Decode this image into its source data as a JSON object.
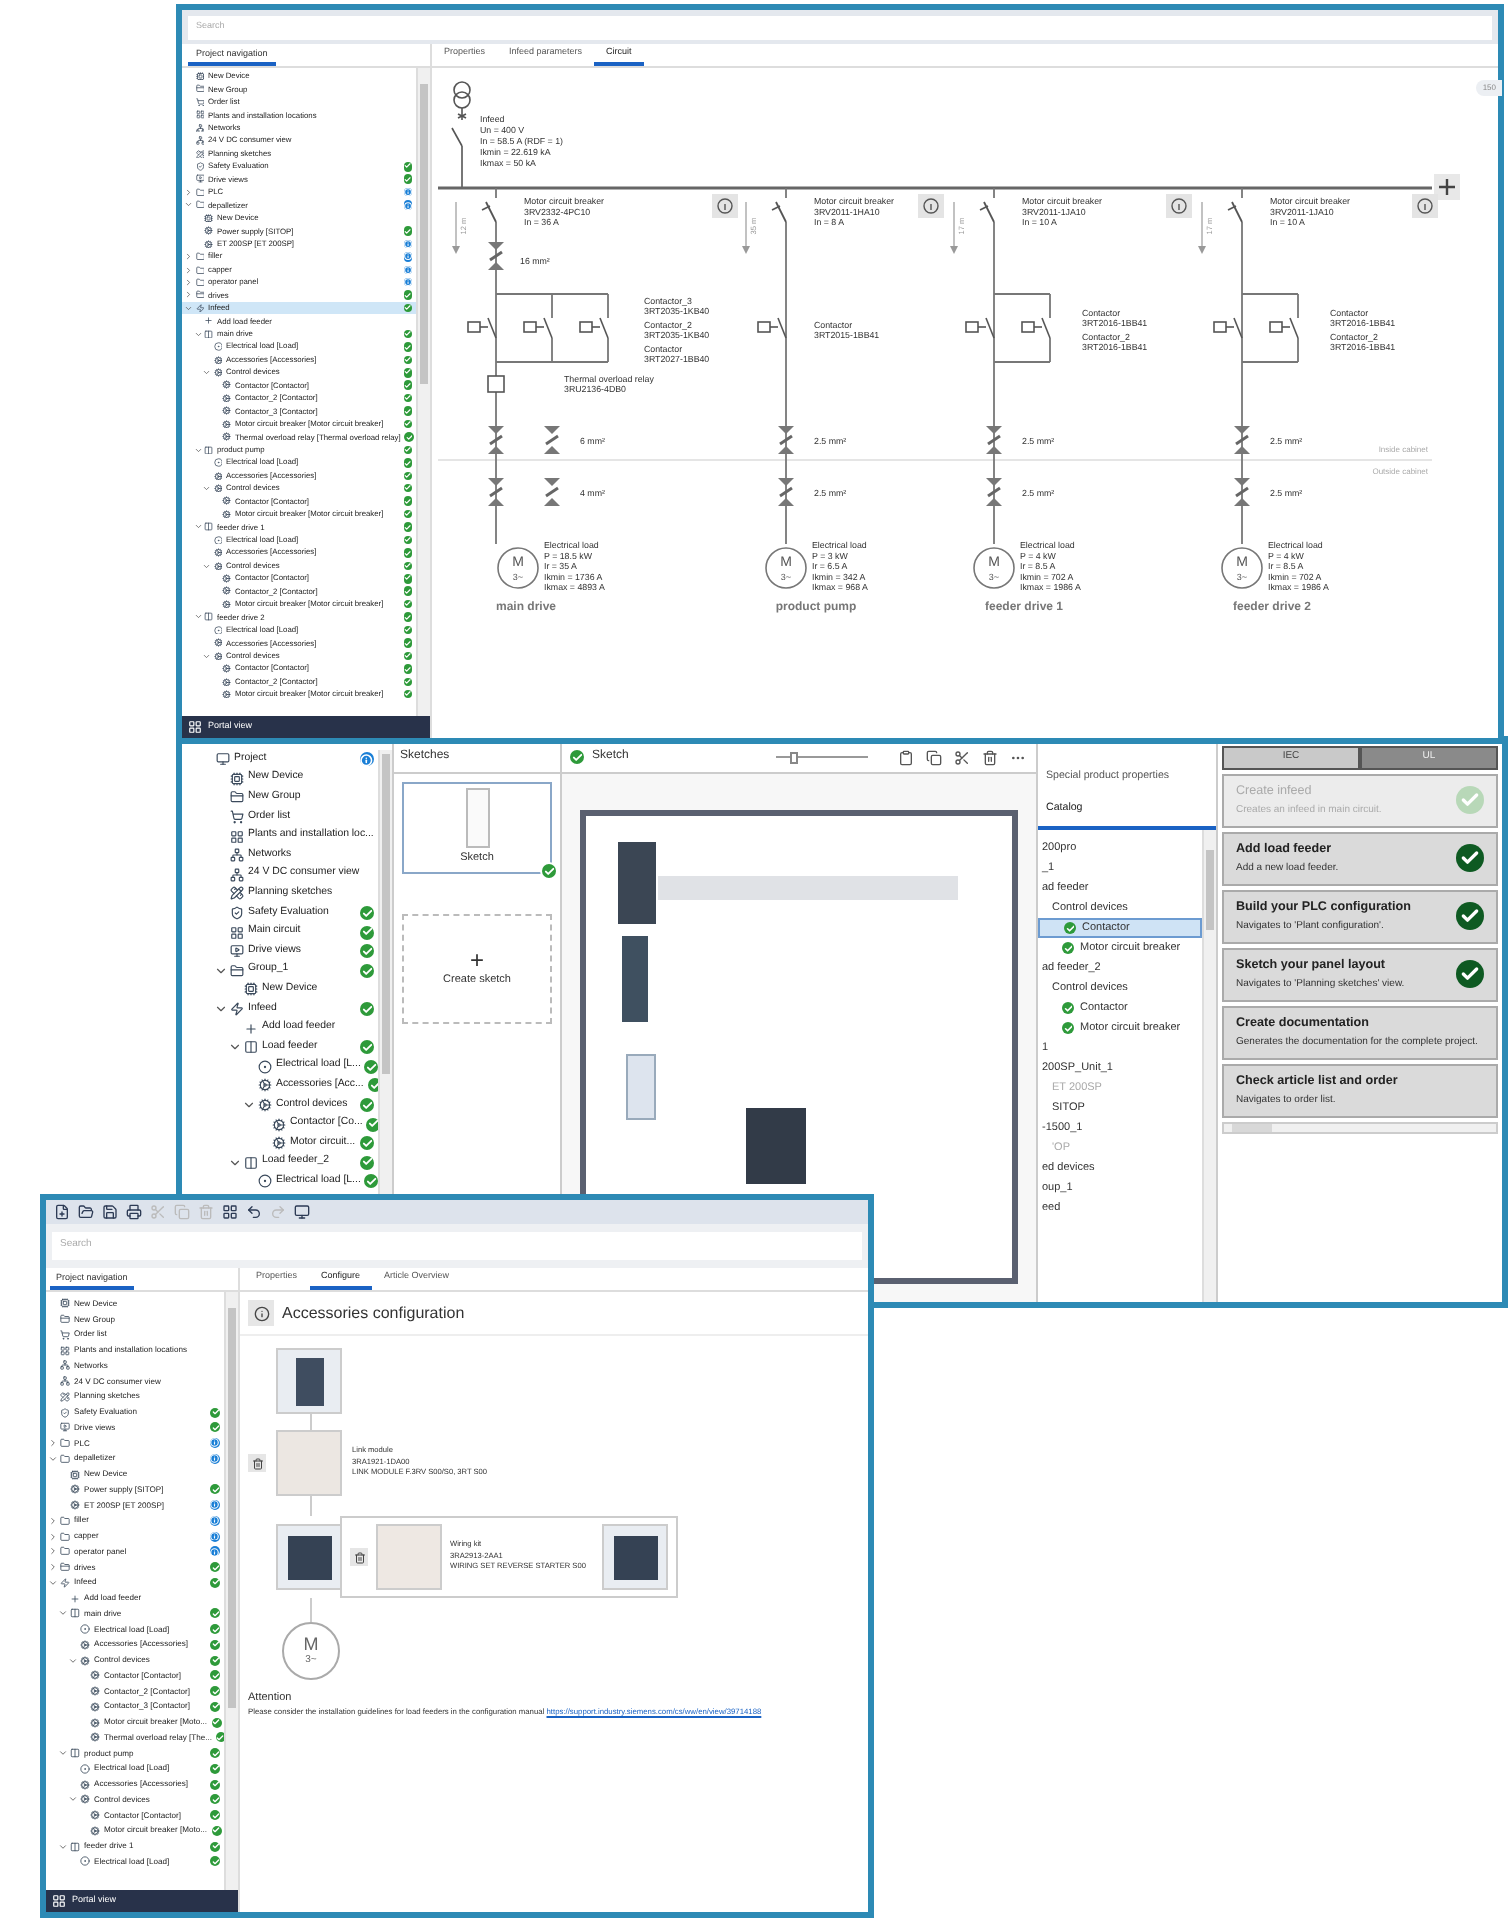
{
  "circuit_window": {
    "search": {
      "placeholder": "Search"
    },
    "nav_tab": "Project navigation",
    "tree": [
      {
        "label": "New Device",
        "kind": "device",
        "selected": false
      },
      {
        "label": "New Group",
        "kind": "group",
        "selected": false
      },
      {
        "label": "Order list",
        "kind": "cart",
        "selected": false
      },
      {
        "label": "Plants and installation locations",
        "kind": "plant",
        "selected": false
      },
      {
        "label": "Networks",
        "kind": "network",
        "selected": false
      },
      {
        "label": "24 V DC consumer view",
        "kind": "network",
        "selected": false
      },
      {
        "label": "Planning sketches",
        "kind": "sketch",
        "selected": false
      },
      {
        "label": "Safety Evaluation",
        "kind": "safety",
        "ok": true,
        "selected": false
      },
      {
        "label": "Drive views",
        "kind": "drive",
        "ok": true,
        "selected": false
      },
      {
        "label": "PLC",
        "kind": "folder",
        "ok": false,
        "expanded": false,
        "selected": false
      },
      {
        "label": "depalletizer",
        "kind": "folder",
        "ok": false,
        "expanded": true,
        "selected": false,
        "children": [
          {
            "label": "New Device",
            "kind": "device",
            "selected": false
          },
          {
            "label": "Power supply [SITOP]",
            "kind": "module",
            "ok": true,
            "selected": false
          },
          {
            "label": "ET 200SP [ET 200SP]",
            "kind": "module",
            "ok": false,
            "selected": false
          }
        ]
      },
      {
        "label": "filler",
        "kind": "folder",
        "ok": false,
        "expanded": false,
        "selected": false
      },
      {
        "label": "capper",
        "kind": "folder",
        "ok": false,
        "expanded": false,
        "selected": false
      },
      {
        "label": "operator panel",
        "kind": "folder",
        "ok": false,
        "expanded": false,
        "selected": false
      },
      {
        "label": "drives",
        "kind": "group",
        "ok": true,
        "expanded": false,
        "selected": false
      },
      {
        "label": "Infeed",
        "kind": "infeed",
        "ok": true,
        "expanded": true,
        "selected": true,
        "children": [
          {
            "label": "Add load feeder",
            "kind": "add",
            "selected": false
          },
          {
            "label": "main drive",
            "kind": "feeder",
            "ok": true,
            "expanded": true,
            "selected": false,
            "children": [
              {
                "label": "Electrical load [Load]",
                "kind": "load",
                "ok": true,
                "selected": false
              },
              {
                "label": "Accessories [Accessories]",
                "kind": "module",
                "ok": true,
                "selected": false
              },
              {
                "label": "Control devices",
                "kind": "module",
                "ok": true,
                "expanded": true,
                "selected": false,
                "children": [
                  {
                    "label": "Contactor [Contactor]",
                    "kind": "module",
                    "ok": true,
                    "selected": false
                  },
                  {
                    "label": "Contactor_2 [Contactor]",
                    "kind": "module",
                    "ok": true,
                    "selected": false
                  },
                  {
                    "label": "Contactor_3 [Contactor]",
                    "kind": "module",
                    "ok": true,
                    "selected": false
                  },
                  {
                    "label": "Motor circuit breaker [Motor circuit breaker]",
                    "kind": "module",
                    "ok": true,
                    "selected": false
                  },
                  {
                    "label": "Thermal overload relay [Thermal overload relay]",
                    "kind": "module",
                    "ok": true,
                    "selected": false
                  }
                ]
              }
            ]
          },
          {
            "label": "product pump",
            "kind": "feeder",
            "ok": true,
            "expanded": true,
            "selected": false,
            "children": [
              {
                "label": "Electrical load [Load]",
                "kind": "load",
                "ok": true,
                "selected": false
              },
              {
                "label": "Accessories [Accessories]",
                "kind": "module",
                "ok": true,
                "selected": false
              },
              {
                "label": "Control devices",
                "kind": "module",
                "ok": true,
                "expanded": true,
                "selected": false,
                "children": [
                  {
                    "label": "Contactor [Contactor]",
                    "kind": "module",
                    "ok": true,
                    "selected": false
                  },
                  {
                    "label": "Motor circuit breaker [Motor circuit breaker]",
                    "kind": "module",
                    "ok": true,
                    "selected": false
                  }
                ]
              }
            ]
          },
          {
            "label": "feeder drive 1",
            "kind": "feeder",
            "ok": true,
            "expanded": true,
            "selected": false,
            "children": [
              {
                "label": "Electrical load [Load]",
                "kind": "load",
                "ok": true,
                "selected": false
              },
              {
                "label": "Accessories [Accessories]",
                "kind": "module",
                "ok": true,
                "selected": false
              },
              {
                "label": "Control devices",
                "kind": "module",
                "ok": true,
                "expanded": true,
                "selected": false,
                "children": [
                  {
                    "label": "Contactor [Contactor]",
                    "kind": "module",
                    "ok": true,
                    "selected": false
                  },
                  {
                    "label": "Contactor_2 [Contactor]",
                    "kind": "module",
                    "ok": true,
                    "selected": false
                  },
                  {
                    "label": "Motor circuit breaker [Motor circuit breaker]",
                    "kind": "module",
                    "ok": true,
                    "selected": false
                  }
                ]
              }
            ]
          },
          {
            "label": "feeder drive 2",
            "kind": "feeder",
            "ok": true,
            "expanded": true,
            "selected": false,
            "children": [
              {
                "label": "Electrical load [Load]",
                "kind": "load",
                "ok": true,
                "selected": false
              },
              {
                "label": "Accessories [Accessories]",
                "kind": "module",
                "ok": true,
                "selected": false
              },
              {
                "label": "Control devices",
                "kind": "module",
                "ok": true,
                "expanded": true,
                "selected": false,
                "children": [
                  {
                    "label": "Contactor [Contactor]",
                    "kind": "module",
                    "ok": true,
                    "selected": false
                  },
                  {
                    "label": "Contactor_2 [Contactor]",
                    "kind": "module",
                    "ok": true,
                    "selected": false
                  },
                  {
                    "label": "Motor circuit breaker [Motor circuit breaker]",
                    "kind": "module",
                    "ok": true,
                    "selected": false
                  }
                ]
              }
            ]
          }
        ]
      }
    ],
    "portal_view": "Portal view",
    "tabs": [
      {
        "label": "Properties",
        "selected": false
      },
      {
        "label": "Infeed parameters",
        "selected": false
      },
      {
        "label": "Circuit",
        "selected": true
      }
    ],
    "zoom_badge": "150",
    "infeed": [
      "Infeed",
      "Un = 400 V",
      "In = 58.5 A (RDF = 1)",
      "Ikmin = 22.619 kA",
      "Ikmax = 50 kA"
    ],
    "cabinet_labels": [
      "Inside cabinet",
      "Outside cabinet"
    ],
    "feeders": [
      {
        "name": "main drive",
        "breaker": [
          "Motor circuit breaker",
          "3RV2332-4PC10",
          "In = 36 A"
        ],
        "distance": "12 m",
        "supply_cable": "16 mm²",
        "contactors": [
          [
            "Contactor_3",
            "3RT2035-1KB40"
          ],
          [
            "Contactor_2",
            "3RT2035-1KB40"
          ],
          [
            "Contactor",
            "3RT2027-1BB40"
          ]
        ],
        "relay": [
          "Thermal overload relay",
          "3RU2136-4DB0"
        ],
        "cables": [
          "6 mm²",
          "4 mm²"
        ],
        "load": [
          "Electrical load",
          "P = 18.5 kW",
          "Ir = 35 A",
          "Ikmin = 1736 A",
          "Ikmax = 4893 A"
        ],
        "motor": [
          "M",
          "3~"
        ]
      },
      {
        "name": "product pump",
        "breaker": [
          "Motor circuit breaker",
          "3RV2011-1HA10",
          "In = 8 A"
        ],
        "distance": "35 m",
        "contactors": [
          [
            "Contactor",
            "3RT2015-1BB41"
          ]
        ],
        "cables": [
          "2.5 mm²",
          "2.5 mm²"
        ],
        "load": [
          "Electrical load",
          "P = 3 kW",
          "Ir = 6.5 A",
          "Ikmin = 342 A",
          "Ikmax = 968 A"
        ],
        "motor": [
          "M",
          "3~"
        ]
      },
      {
        "name": "feeder drive 1",
        "breaker": [
          "Motor circuit breaker",
          "3RV2011-1JA10",
          "In = 10 A"
        ],
        "distance": "17 m",
        "contactors": [
          [
            "Contactor",
            "3RT2016-1BB41"
          ],
          [
            "Contactor_2",
            "3RT2016-1BB41"
          ]
        ],
        "cables": [
          "2.5 mm²",
          "2.5 mm²"
        ],
        "load": [
          "Electrical load",
          "P = 4 kW",
          "Ir = 8.5 A",
          "Ikmin = 702 A",
          "Ikmax = 1986 A"
        ],
        "motor": [
          "M",
          "3~"
        ]
      },
      {
        "name": "feeder drive 2",
        "breaker": [
          "Motor circuit breaker",
          "3RV2011-1JA10",
          "In = 10 A"
        ],
        "distance": "17 m",
        "contactors": [
          [
            "Contactor",
            "3RT2016-1BB41"
          ],
          [
            "Contactor_2",
            "3RT2016-1BB41"
          ]
        ],
        "cables": [
          "2.5 mm²",
          "2.5 mm²"
        ],
        "load": [
          "Electrical load",
          "P = 4 kW",
          "Ir = 8.5 A",
          "Ikmin = 702 A",
          "Ikmax = 1986 A"
        ],
        "motor": [
          "M",
          "3~"
        ]
      }
    ]
  },
  "sketch_window": {
    "tree": [
      {
        "label": "Project",
        "kind": "project",
        "ok": false,
        "children": [
          {
            "label": "New Device",
            "kind": "device"
          },
          {
            "label": "New Group",
            "kind": "group"
          },
          {
            "label": "Order list",
            "kind": "cart"
          },
          {
            "label": "Plants and installation loc...",
            "kind": "plant"
          },
          {
            "label": "Networks",
            "kind": "network"
          },
          {
            "label": "24 V DC consumer view",
            "kind": "network"
          },
          {
            "label": "Planning sketches",
            "kind": "sketch"
          },
          {
            "label": "Safety Evaluation",
            "kind": "safety",
            "ok": true
          },
          {
            "label": "Main circuit",
            "kind": "plant",
            "ok": true
          },
          {
            "label": "Drive views",
            "kind": "drive",
            "ok": true
          },
          {
            "label": "Group_1",
            "kind": "group",
            "ok": true,
            "expanded": true,
            "children": [
              {
                "label": "New Device",
                "kind": "device"
              }
            ]
          },
          {
            "label": "Infeed",
            "kind": "infeed",
            "ok": true,
            "expanded": true,
            "children": [
              {
                "label": "Add load feeder",
                "kind": "add"
              },
              {
                "label": "Load feeder",
                "kind": "feeder",
                "ok": true,
                "expanded": true,
                "children": [
                  {
                    "label": "Electrical load [L...",
                    "kind": "load",
                    "ok": true
                  },
                  {
                    "label": "Accessories [Acc...",
                    "kind": "module",
                    "ok": true
                  },
                  {
                    "label": "Control devices",
                    "kind": "module",
                    "ok": true,
                    "expanded": true,
                    "children": [
                      {
                        "label": "Contactor [Co...",
                        "kind": "module",
                        "ok": true
                      },
                      {
                        "label": "Motor circuit...",
                        "kind": "module",
                        "ok": true
                      }
                    ]
                  }
                ]
              },
              {
                "label": "Load feeder_2",
                "kind": "feeder",
                "ok": true,
                "expanded": true,
                "children": [
                  {
                    "label": "Electrical load [L...",
                    "kind": "load",
                    "ok": true
                  }
                ]
              }
            ]
          }
        ]
      }
    ],
    "sketches_title": "Sketches",
    "sketches": [
      {
        "label": "Sketch",
        "ok": true
      }
    ],
    "create_sketch": {
      "icon": "+",
      "label": "Create sketch"
    },
    "editor_title": "Sketch",
    "editor_ok": true,
    "zoom_slider": {
      "level": 0.2
    },
    "toolbar": [
      {
        "kind": "paste"
      },
      {
        "kind": "copy"
      },
      {
        "kind": "cut"
      },
      {
        "kind": "delete"
      },
      {
        "kind": "more"
      }
    ],
    "catalog_tabs": [
      {
        "label": "Special product properties",
        "selected": false
      },
      {
        "label": "Catalog",
        "selected": true
      }
    ],
    "catalog": [
      {
        "label": "200pro",
        "selected": false,
        "muted": false
      },
      {
        "label": "_1",
        "selected": false,
        "muted": false
      },
      {
        "label": "ad feeder",
        "selected": false,
        "muted": false,
        "children": [
          {
            "label": "Control devices",
            "selected": false,
            "muted": false,
            "children": [
              {
                "label": "Contactor",
                "ok": true,
                "selected": true,
                "muted": false
              },
              {
                "label": "Motor circuit breaker",
                "ok": true,
                "selected": false,
                "muted": false
              }
            ]
          }
        ]
      },
      {
        "label": "ad feeder_2",
        "selected": false,
        "muted": false,
        "children": [
          {
            "label": "Control devices",
            "selected": false,
            "muted": false,
            "children": [
              {
                "label": "Contactor",
                "ok": true,
                "selected": false,
                "muted": false
              },
              {
                "label": "Motor circuit breaker",
                "ok": true,
                "selected": false,
                "muted": false
              }
            ]
          }
        ]
      },
      {
        "label": "1",
        "selected": false,
        "muted": false
      },
      {
        "label": "200SP_Unit_1",
        "selected": false,
        "muted": false,
        "children": [
          {
            "label": "ET 200SP",
            "selected": false,
            "muted": true
          },
          {
            "label": "SITOP",
            "selected": false,
            "muted": false
          }
        ]
      },
      {
        "label": "-1500_1",
        "selected": false,
        "muted": false,
        "children": [
          {
            "label": "'OP",
            "selected": false,
            "muted": true
          }
        ]
      },
      {
        "label": "ed devices",
        "selected": false,
        "muted": false
      },
      {
        "label": "oup_1",
        "selected": false,
        "muted": false
      },
      {
        "label": "eed",
        "selected": false,
        "muted": false
      }
    ],
    "standard_tabs": [
      {
        "label": "IEC",
        "selected": true
      },
      {
        "label": "UL",
        "selected": false
      }
    ],
    "steps": [
      {
        "title": "Create infeed",
        "text": "Creates an infeed in main circuit.",
        "done": true,
        "disabled": true
      },
      {
        "title": "Add load feeder",
        "text": "Add a new load feeder.",
        "done": true,
        "disabled": false
      },
      {
        "title": "Build your PLC configuration",
        "text": "Navigates to 'Plant configuration'.",
        "done": true,
        "disabled": false
      },
      {
        "title": "Sketch your panel layout",
        "text": "Navigates to 'Planning sketches' view.",
        "done": true,
        "disabled": false
      },
      {
        "title": "Create documentation",
        "text": "Generates the documentation for the complete project.",
        "done": false,
        "disabled": false
      },
      {
        "title": "Check article list and order",
        "text": "Navigates to order list.",
        "done": false,
        "disabled": false
      }
    ]
  },
  "configure_window": {
    "toolbar": [
      {
        "kind": "new",
        "disabled": false
      },
      {
        "kind": "open",
        "disabled": false
      },
      {
        "kind": "save",
        "disabled": false
      },
      {
        "kind": "print",
        "disabled": false
      },
      {
        "kind": "cut",
        "disabled": true
      },
      {
        "kind": "copy",
        "disabled": true
      },
      {
        "kind": "delete",
        "disabled": true
      },
      {
        "kind": "grid",
        "disabled": false
      },
      {
        "kind": "undo",
        "disabled": false
      },
      {
        "kind": "redo",
        "disabled": true
      },
      {
        "kind": "portal",
        "disabled": false
      }
    ],
    "search": {
      "placeholder": "Search"
    },
    "nav_tab": "Project navigation",
    "tree": [
      {
        "label": "New Device",
        "kind": "device"
      },
      {
        "label": "New Group",
        "kind": "group"
      },
      {
        "label": "Order list",
        "kind": "cart"
      },
      {
        "label": "Plants and installation locations",
        "kind": "plant"
      },
      {
        "label": "Networks",
        "kind": "network"
      },
      {
        "label": "24 V DC consumer view",
        "kind": "network"
      },
      {
        "label": "Planning sketches",
        "kind": "sketch"
      },
      {
        "label": "Safety Evaluation",
        "kind": "safety",
        "ok": true
      },
      {
        "label": "Drive views",
        "kind": "drive",
        "ok": true
      },
      {
        "label": "PLC",
        "kind": "folder",
        "ok": false,
        "expanded": false
      },
      {
        "label": "depalletizer",
        "kind": "folder",
        "ok": false,
        "expanded": true,
        "children": [
          {
            "label": "New Device",
            "kind": "device"
          },
          {
            "label": "Power supply [SITOP]",
            "kind": "module",
            "ok": true
          },
          {
            "label": "ET 200SP [ET 200SP]",
            "kind": "module",
            "ok": false
          }
        ]
      },
      {
        "label": "filler",
        "kind": "folder",
        "ok": false,
        "expanded": false
      },
      {
        "label": "capper",
        "kind": "folder",
        "ok": false,
        "expanded": false
      },
      {
        "label": "operator panel",
        "kind": "folder",
        "ok": false,
        "expanded": false
      },
      {
        "label": "drives",
        "kind": "group",
        "ok": true,
        "expanded": false
      },
      {
        "label": "Infeed",
        "kind": "infeed",
        "ok": true,
        "expanded": true,
        "children": [
          {
            "label": "Add load feeder",
            "kind": "add"
          },
          {
            "label": "main drive",
            "kind": "feeder",
            "ok": true,
            "expanded": true,
            "children": [
              {
                "label": "Electrical load [Load]",
                "kind": "load",
                "ok": true
              },
              {
                "label": "Accessories [Accessories]",
                "kind": "module",
                "ok": true
              },
              {
                "label": "Control devices",
                "kind": "module",
                "ok": true,
                "expanded": true,
                "children": [
                  {
                    "label": "Contactor [Contactor]",
                    "kind": "module",
                    "ok": true
                  },
                  {
                    "label": "Contactor_2 [Contactor]",
                    "kind": "module",
                    "ok": true
                  },
                  {
                    "label": "Contactor_3 [Contactor]",
                    "kind": "module",
                    "ok": true
                  },
                  {
                    "label": "Motor circuit breaker [Moto...",
                    "kind": "module",
                    "ok": true
                  },
                  {
                    "label": "Thermal overload relay [The...",
                    "kind": "module",
                    "ok": true
                  }
                ]
              }
            ]
          },
          {
            "label": "product pump",
            "kind": "feeder",
            "ok": true,
            "expanded": true,
            "children": [
              {
                "label": "Electrical load [Load]",
                "kind": "load",
                "ok": true
              },
              {
                "label": "Accessories [Accessories]",
                "kind": "module",
                "ok": true
              },
              {
                "label": "Control devices",
                "kind": "module",
                "ok": true,
                "expanded": true,
                "children": [
                  {
                    "label": "Contactor [Contactor]",
                    "kind": "module",
                    "ok": true
                  },
                  {
                    "label": "Motor circuit breaker [Moto...",
                    "kind": "module",
                    "ok": true
                  }
                ]
              }
            ]
          },
          {
            "label": "feeder drive 1",
            "kind": "feeder",
            "ok": true,
            "expanded": true,
            "children": [
              {
                "label": "Electrical load [Load]",
                "kind": "load",
                "ok": true
              }
            ]
          }
        ]
      }
    ],
    "portal_view": "Portal view",
    "tabs": [
      {
        "label": "Properties",
        "selected": false
      },
      {
        "label": "Configure",
        "selected": true
      },
      {
        "label": "Article Overview",
        "selected": false
      }
    ],
    "heading": "Accessories configuration",
    "link_module": [
      "Link module",
      "3RA1921-1DA00",
      "LINK MODULE F.3RV S00/S0, 3RT S00"
    ],
    "wiring_kit": [
      "Wiring kit",
      "3RA2913-2AA1",
      "WIRING SET REVERSE STARTER S00"
    ],
    "motor": [
      "M",
      "3~"
    ],
    "attention_title": "Attention",
    "attention_text": "Please consider the installation guidelines for load feeders in the configuration manual",
    "attention_link": "https://support.industry.siemens.com/cs/ww/en/view/39714188"
  }
}
